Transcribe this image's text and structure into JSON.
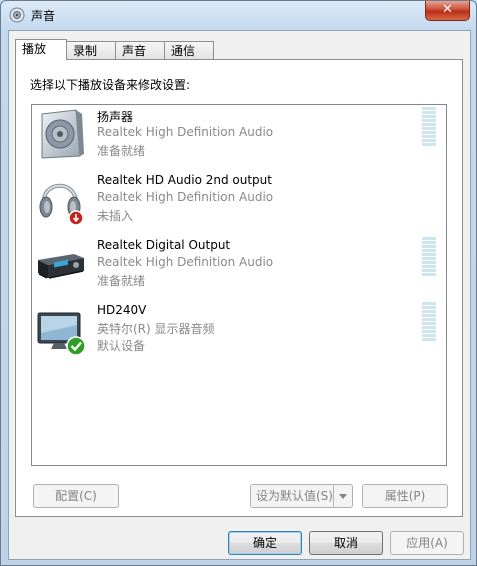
{
  "window": {
    "title": "声音",
    "close_glyph": "✕"
  },
  "tabs": [
    {
      "label": "播放",
      "active": true
    },
    {
      "label": "录制"
    },
    {
      "label": "声音"
    },
    {
      "label": "通信"
    }
  ],
  "instruction": "选择以下播放设备来修改设置:",
  "devices": [
    {
      "name": "扬声器",
      "description": "Realtek High Definition Audio",
      "status": "准备就绪",
      "icon": "speaker-icon",
      "has_meter": true
    },
    {
      "name": "Realtek HD Audio 2nd output",
      "description": "Realtek High Definition Audio",
      "status": "未插入",
      "icon": "headphones-icon",
      "has_meter": false
    },
    {
      "name": "Realtek Digital Output",
      "description": "Realtek High Definition Audio",
      "status": "准备就绪",
      "icon": "digital-receiver-icon",
      "has_meter": true
    },
    {
      "name": "HD240V",
      "description": "英特尔(R) 显示器音频",
      "status": "默认设备",
      "icon": "monitor-icon",
      "has_meter": true
    }
  ],
  "panel_buttons": {
    "configure": "配置(C)",
    "set_default": "设为默认值(S)",
    "properties": "属性(P)"
  },
  "dialog_buttons": {
    "ok": "确定",
    "cancel": "取消",
    "apply": "应用(A)"
  },
  "colors": {
    "title_close": "#c8452c",
    "default_check": "#2fa024",
    "unplugged_badge": "#c8201a"
  }
}
